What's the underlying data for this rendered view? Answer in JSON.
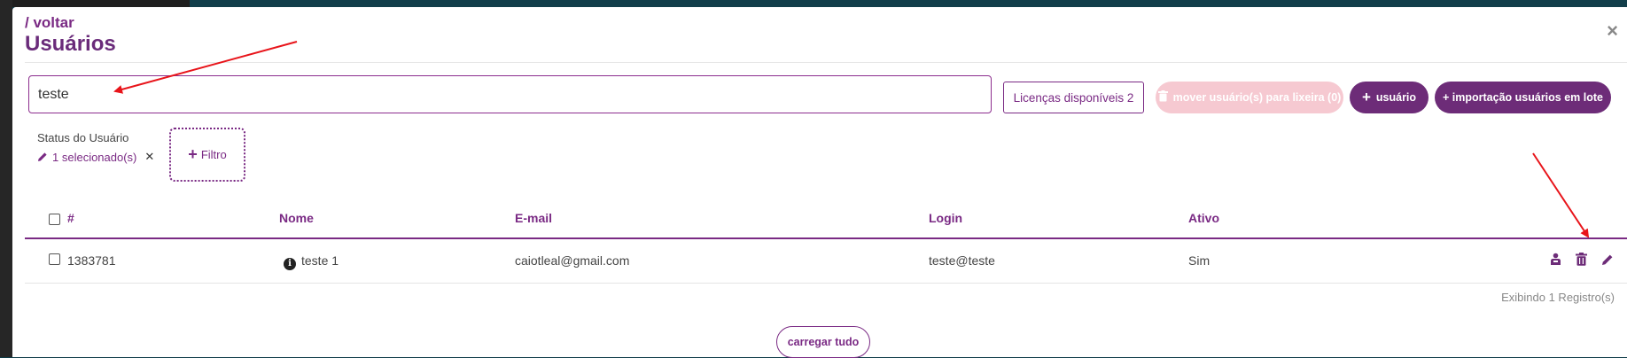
{
  "header": {
    "back_label": "/ voltar",
    "title": "Usuários",
    "close_glyph": "×"
  },
  "search": {
    "value": "teste"
  },
  "toolbar": {
    "licenses_label": "Licenças disponíveis 2",
    "trash_label": "mover usuário(s) para lixeira (0)",
    "add_user_label": "usuário",
    "import_label": "+ importação usuários em lote"
  },
  "filters": {
    "status_label": "Status do Usuário",
    "status_value": "1 selecionado(s)",
    "add_filter_label": "Filtro"
  },
  "table": {
    "columns": [
      "#",
      "Nome",
      "E-mail",
      "Login",
      "Ativo"
    ],
    "rows": [
      {
        "id": "1383781",
        "name": "teste 1",
        "email": "caiotleal@gmail.com",
        "login": "teste@teste",
        "active": "Sim"
      }
    ]
  },
  "footer": {
    "records_label": "Exibindo 1 Registro(s)",
    "load_all_label": "carregar tudo"
  },
  "colors": {
    "accent": "#7a2a84",
    "button_fill": "#6d2c78",
    "disabled_fill": "#f6c9d1",
    "annotation_arrow": "#e8141a"
  },
  "icons": [
    "close-icon",
    "trash-icon",
    "plus-icon",
    "pencil-icon",
    "info-icon",
    "user-group-icon",
    "edit-icon"
  ]
}
